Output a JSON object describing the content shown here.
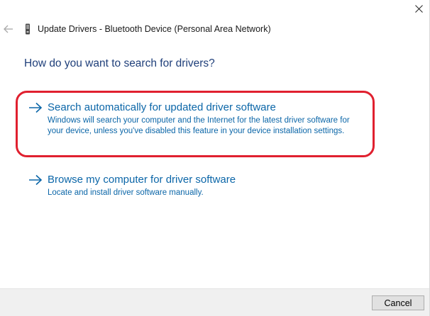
{
  "window": {
    "title": "Update Drivers - Bluetooth Device (Personal Area Network)"
  },
  "icons": {
    "close": "close-icon",
    "back": "back-arrow-icon",
    "device": "device-icon",
    "option_arrow": "arrow-right-icon"
  },
  "question": "How do you want to search for drivers?",
  "options": [
    {
      "title": "Search automatically for updated driver software",
      "description": "Windows will search your computer and the Internet for the latest driver software for your device, unless you've disabled this feature in your device installation settings."
    },
    {
      "title": "Browse my computer for driver software",
      "description": "Locate and install driver software manually."
    }
  ],
  "footer": {
    "cancel_label": "Cancel"
  },
  "colors": {
    "link_blue": "#0b66a8",
    "heading_blue": "#1f3f7a",
    "highlight_red": "#e0202f",
    "footer_bg": "#f0f0f0"
  }
}
